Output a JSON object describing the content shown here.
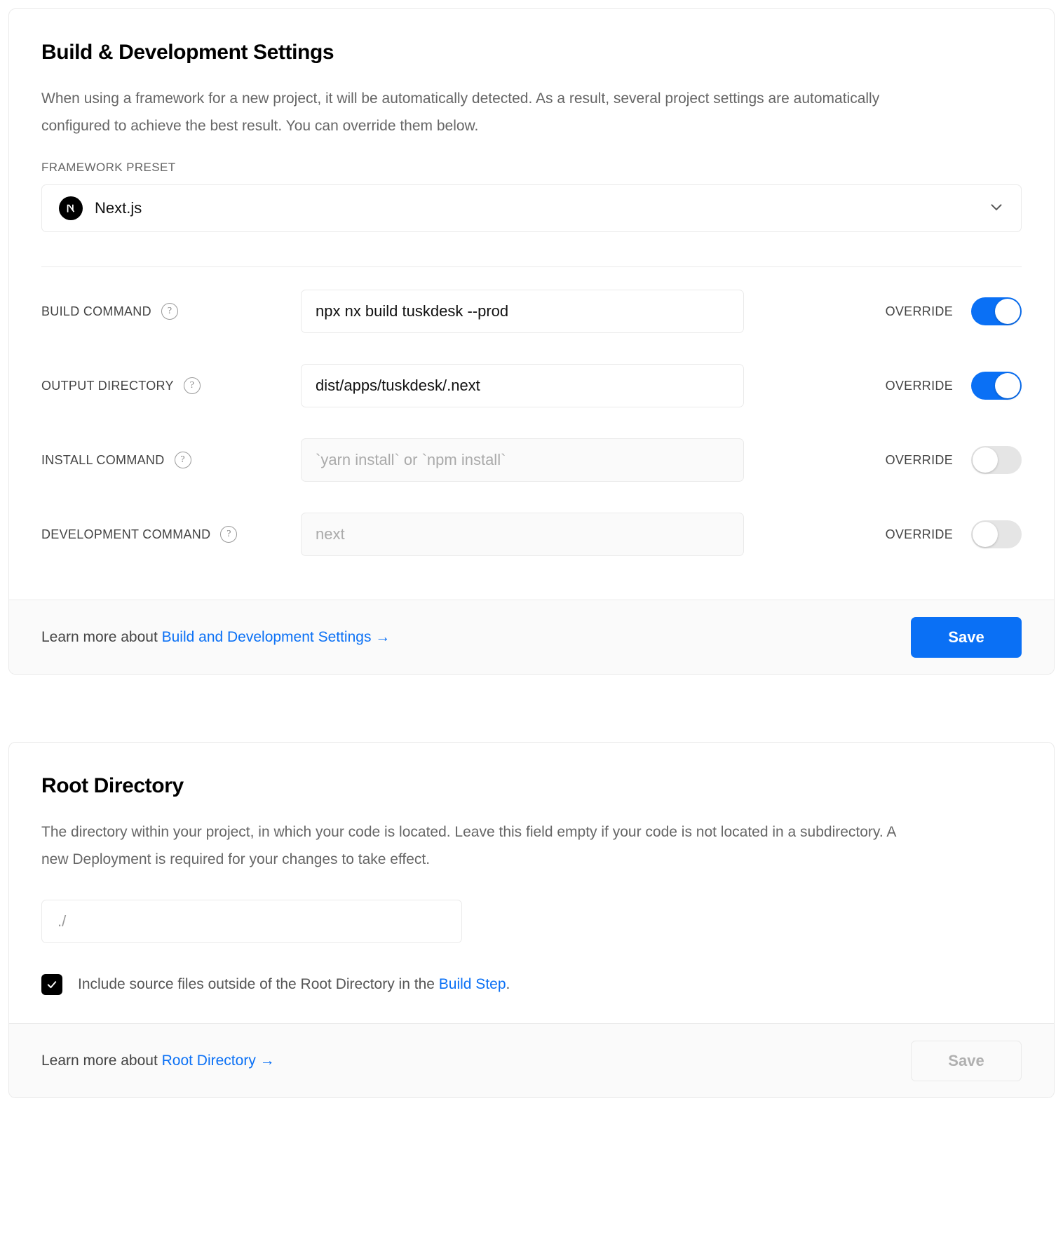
{
  "build_card": {
    "title": "Build & Development Settings",
    "description": "When using a framework for a new project, it will be automatically detected. As a result, several project settings are automatically configured to achieve the best result. You can override them below.",
    "framework_preset": {
      "label": "FRAMEWORK PRESET",
      "value": "Next.js",
      "logo_icon": "nextjs-logo-icon",
      "chevron_icon": "chevron-down-icon"
    },
    "override_label": "OVERRIDE",
    "help_icon_glyph": "?",
    "rows": [
      {
        "label": "BUILD COMMAND",
        "value": "npx nx build tuskdesk --prod",
        "placeholder": "",
        "override_on": true,
        "disabled": false
      },
      {
        "label": "OUTPUT DIRECTORY",
        "value": "dist/apps/tuskdesk/.next",
        "placeholder": "",
        "override_on": true,
        "disabled": false
      },
      {
        "label": "INSTALL COMMAND",
        "value": "",
        "placeholder": "`yarn install` or `npm install`",
        "override_on": false,
        "disabled": true
      },
      {
        "label": "DEVELOPMENT COMMAND",
        "value": "",
        "placeholder": "next",
        "override_on": false,
        "disabled": true
      }
    ],
    "footer": {
      "learn_prefix": "Learn more about ",
      "learn_link": "Build and Development Settings →",
      "save_label": "Save",
      "save_enabled": true
    }
  },
  "root_card": {
    "title": "Root Directory",
    "description": "The directory within your project, in which your code is located. Leave this field empty if your code is not located in a subdirectory. A new Deployment is required for your changes to take effect.",
    "input_placeholder": "./",
    "input_value": "",
    "checkbox": {
      "checked": true,
      "check_glyph": "✓",
      "label_prefix": "Include source files outside of the Root Directory in the ",
      "label_link": "Build Step",
      "label_suffix": "."
    },
    "footer": {
      "learn_prefix": "Learn more about ",
      "learn_link": "Root Directory →",
      "save_label": "Save",
      "save_enabled": false
    }
  },
  "colors": {
    "accent_blue": "#0a70f5",
    "border": "#eaeaea",
    "footer_bg": "#fafafa",
    "text_muted": "#666666"
  }
}
